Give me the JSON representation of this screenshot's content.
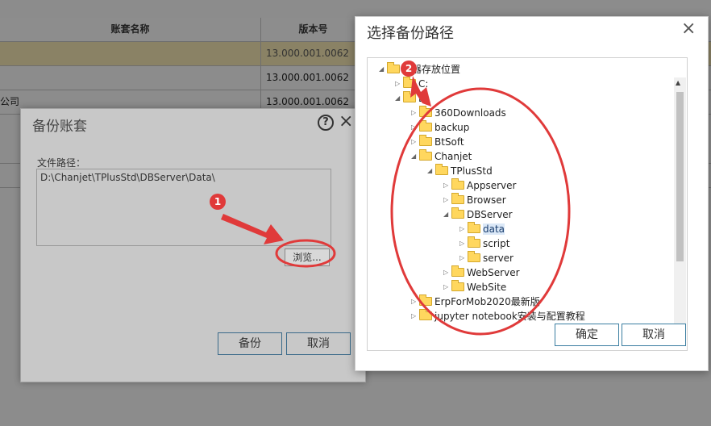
{
  "table": {
    "headers": {
      "name": "账套名称",
      "version": "版本号"
    },
    "rows": [
      {
        "name": "",
        "version": "13.000.001.0062"
      },
      {
        "name": "",
        "version": "13.000.001.0062"
      },
      {
        "name": "公司",
        "version": "13.000.001.0062"
      }
    ]
  },
  "backup_dialog": {
    "title": "备份账套",
    "path_label": "文件路径：",
    "path_value": "D:\\Chanjet\\TPlusStd\\DBServer\\Data\\",
    "browse_label": "浏览...",
    "backup_label": "备份",
    "cancel_label": "取消",
    "help_icon": "?",
    "close_icon": "×"
  },
  "path_dialog": {
    "title": "选择备份路径",
    "close_icon": "×",
    "confirm_label": "确定",
    "cancel_label": "取消",
    "tree": [
      {
        "label": "务器存放位置",
        "level": 0,
        "expanded": true
      },
      {
        "label": "C:",
        "level": 1,
        "expanded": false
      },
      {
        "label": "D:",
        "level": 1,
        "expanded": true
      },
      {
        "label": "360Downloads",
        "level": 2,
        "expanded": false
      },
      {
        "label": "backup",
        "level": 2,
        "expanded": false
      },
      {
        "label": "BtSoft",
        "level": 2,
        "expanded": false
      },
      {
        "label": "Chanjet",
        "level": 2,
        "expanded": true
      },
      {
        "label": "TPlusStd",
        "level": 3,
        "expanded": true
      },
      {
        "label": "Appserver",
        "level": 4,
        "expanded": false
      },
      {
        "label": "Browser",
        "level": 4,
        "expanded": false
      },
      {
        "label": "DBServer",
        "level": 4,
        "expanded": true
      },
      {
        "label": "data",
        "level": 5,
        "expanded": false,
        "selected": true
      },
      {
        "label": "script",
        "level": 5,
        "expanded": false
      },
      {
        "label": "server",
        "level": 5,
        "expanded": false
      },
      {
        "label": "WebServer",
        "level": 4,
        "expanded": false
      },
      {
        "label": "WebSite",
        "level": 4,
        "expanded": false
      },
      {
        "label": "ErpForMob2020最新版",
        "level": 2,
        "expanded": false
      },
      {
        "label": "jupyter notebook安装与配置教程",
        "level": 2,
        "expanded": false
      }
    ]
  },
  "markers": {
    "m1": "1",
    "m2": "2"
  },
  "colors": {
    "annotation": "#e03a3a",
    "button_border": "#3b7ea1"
  }
}
